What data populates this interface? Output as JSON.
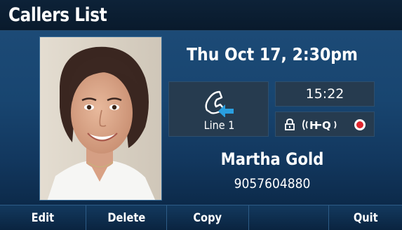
{
  "screen": {
    "title": "Callers List"
  },
  "call_details": {
    "datetime": "Thu Oct 17, 2:30pm",
    "line_label": "Line 1",
    "duration": "15:22",
    "caller_name": "Martha Gold",
    "caller_number": "9057604880",
    "call_direction_icon": "incoming-call-icon",
    "status_icons": [
      "lock-icon",
      "hd-voice-icon",
      "record-icon"
    ]
  },
  "softkeys": [
    {
      "label": "Edit"
    },
    {
      "label": "Delete"
    },
    {
      "label": "Copy"
    },
    {
      "label": ""
    },
    {
      "label": "Quit"
    }
  ],
  "colors": {
    "background": "#184570",
    "title_bar": "#0d2238",
    "panel": "#263b4f",
    "arrow_accent": "#2a9fe0",
    "record_red": "#e0262e"
  }
}
